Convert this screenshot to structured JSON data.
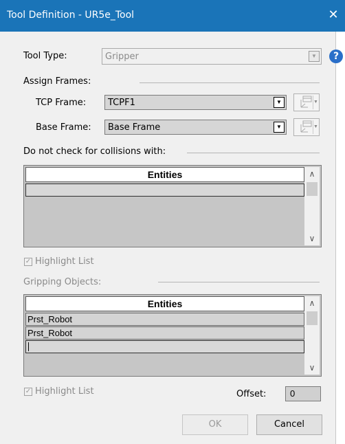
{
  "window": {
    "title": "Tool Definition - UR5e_Tool",
    "close_symbol": "✕"
  },
  "tool_type": {
    "label": "Tool Type:",
    "value": "Gripper",
    "help_symbol": "?"
  },
  "assign_frames": {
    "heading": "Assign Frames:",
    "tcp": {
      "label": "TCP Frame:",
      "value": "TCPF1"
    },
    "base": {
      "label": "Base Frame:",
      "value": "Base Frame"
    }
  },
  "collisions": {
    "heading": "Do not check for collisions with:",
    "column": "Entities",
    "rows": [
      ""
    ],
    "highlight_label": "Highlight List",
    "highlight_checked": true
  },
  "gripping": {
    "heading": "Gripping Objects:",
    "column": "Entities",
    "rows": [
      "Prst_Robot",
      "Prst_Robot"
    ],
    "editing_row": "",
    "highlight_label": "Highlight List",
    "highlight_checked": true,
    "offset_label": "Offset:",
    "offset_value": "0"
  },
  "buttons": {
    "ok": "OK",
    "cancel": "Cancel"
  },
  "icons": {
    "close": "close-icon",
    "help": "help-icon",
    "frame_picker": "frame-picker-icon",
    "dropdown": "chevron-down-icon",
    "scroll_up": "chevron-up-icon",
    "scroll_down": "chevron-down-icon",
    "check": "checkmark-icon"
  },
  "colors": {
    "titlebar": "#1a74b8",
    "help": "#2a6fc9",
    "grid_bg": "#c6c6c6"
  }
}
